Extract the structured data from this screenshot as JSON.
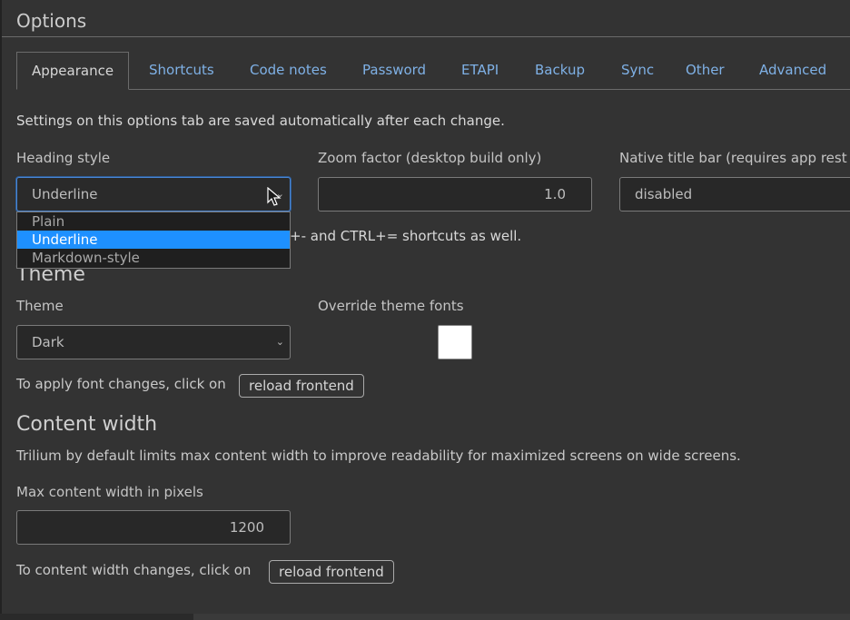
{
  "title": "Options",
  "tabs": [
    "Appearance",
    "Shortcuts",
    "Code notes",
    "Password",
    "ETAPI",
    "Backup",
    "Sync",
    "Other",
    "Advanced"
  ],
  "active_tab": "Appearance",
  "info_text": "Settings on this options tab are saved automatically after each change.",
  "heading_style": {
    "label": "Heading style",
    "value": "Underline",
    "options": [
      "Plain",
      "Underline",
      "Markdown-style"
    ],
    "selected_option": "Underline"
  },
  "zoom": {
    "label": "Zoom factor (desktop build only)",
    "value": "1.0",
    "hint_fragment": "+- and CTRL+= shortcuts as well."
  },
  "native_title_bar": {
    "label": "Native title bar (requires app rest",
    "value": "disabled"
  },
  "theme_section": {
    "heading": "Theme",
    "theme_label": "Theme",
    "theme_value": "Dark",
    "override_label": "Override theme fonts",
    "apply_text": "To apply font changes, click on",
    "reload_button": "reload frontend"
  },
  "content_width": {
    "heading": "Content width",
    "description": "Trilium by default limits max content width to improve readability for maximized screens on wide screens.",
    "max_label": "Max content width in pixels",
    "max_value": "1200",
    "apply_text": "To content width changes, click on",
    "reload_button": "reload frontend"
  },
  "colors": {
    "background": "#333333",
    "tab_link": "#7fb1e6",
    "selection": "#1e90ff",
    "focus_border": "#4a86d4"
  }
}
